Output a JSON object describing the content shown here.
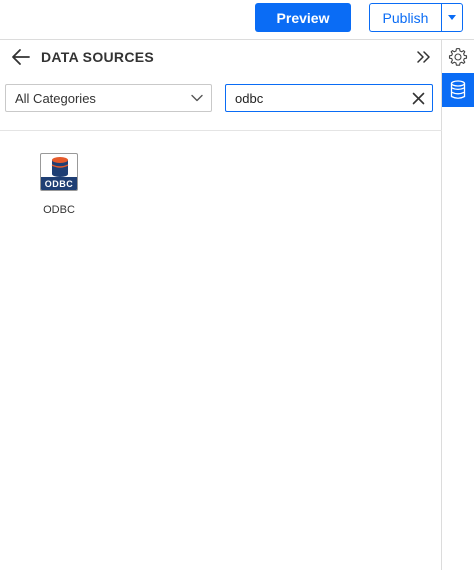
{
  "toolbar": {
    "preview_label": "Preview",
    "publish_label": "Publish",
    "publish_menu_icon": "caret-down-icon"
  },
  "panel": {
    "back_icon": "arrow-left-icon",
    "title": "DATA SOURCES",
    "collapse_icon": "double-chevron-right-icon"
  },
  "filters": {
    "category_selected": "All Categories",
    "search_value": "odbc",
    "clear_icon": "close-icon"
  },
  "datasources": [
    {
      "name": "ODBC",
      "icon_badge": "ODBC",
      "icon": "odbc-database-icon"
    }
  ],
  "sidebar": {
    "items": [
      {
        "icon": "gear-icon",
        "active": false
      },
      {
        "icon": "database-icon",
        "active": true
      }
    ]
  },
  "colors": {
    "accent": "#0a6cf5",
    "odbc_band": "#1f3f74",
    "odbc_cylinder_top": "#e55a2b",
    "odbc_cylinder_body": "#1f3f74"
  }
}
